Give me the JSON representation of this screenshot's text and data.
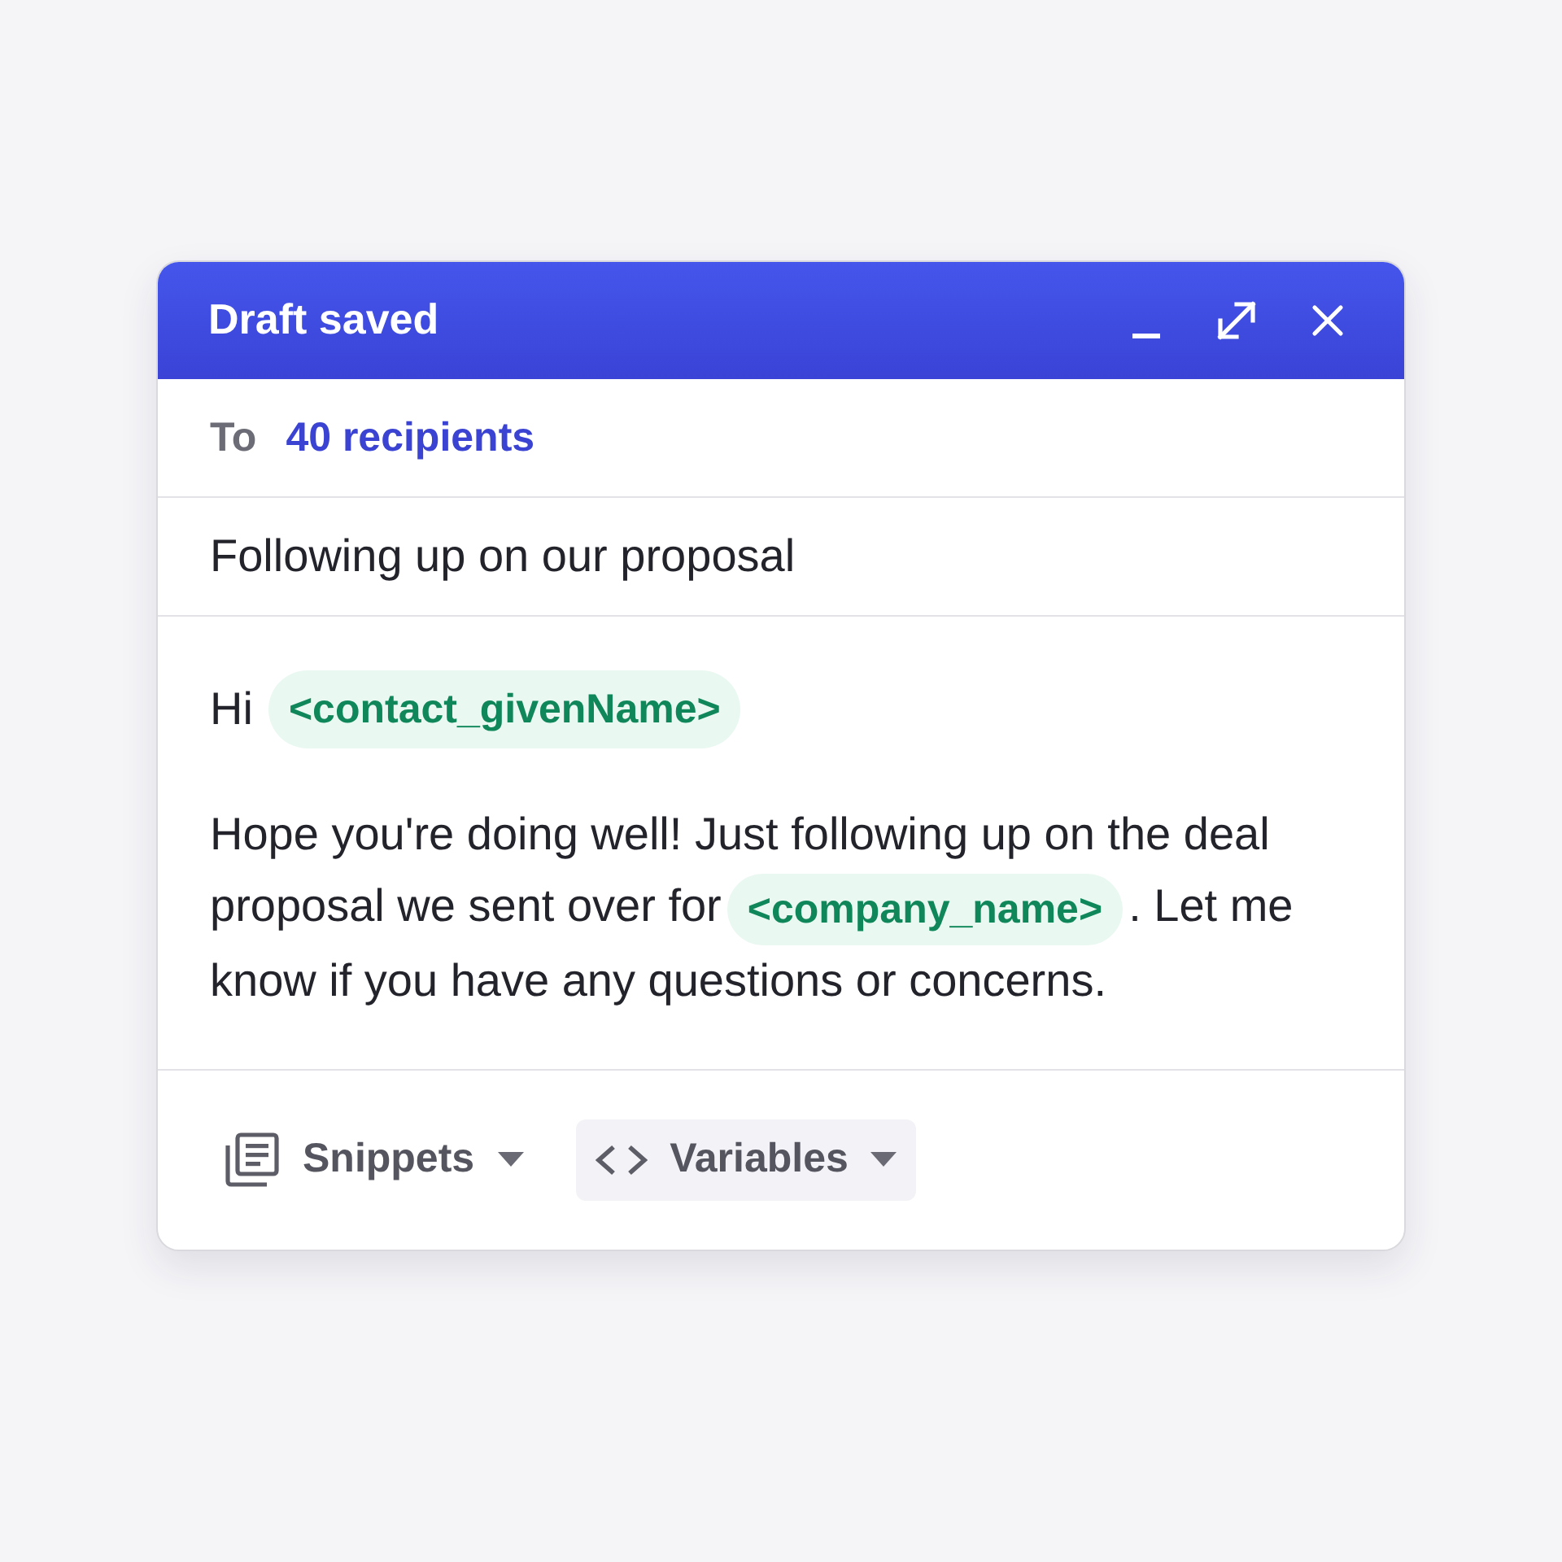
{
  "window": {
    "title": "Draft saved"
  },
  "to": {
    "label": "To",
    "recipients": "40 recipients"
  },
  "subject": "Following up on our proposal",
  "body": {
    "greeting": [
      {
        "kind": "text",
        "text": "Hi"
      },
      {
        "kind": "variable",
        "text": "<contact_givenName>"
      }
    ],
    "paragraph": [
      {
        "kind": "text",
        "text": "Hope you're doing well! Just following up on the deal proposal we sent over for"
      },
      {
        "kind": "variable",
        "text": "<company_name>"
      },
      {
        "kind": "text",
        "text": ". Let me know if you have any questions or concerns."
      }
    ]
  },
  "toolbar": [
    {
      "kind": "snippets",
      "label": "Snippets",
      "selected": false
    },
    {
      "kind": "variables",
      "label": "Variables",
      "selected": true
    }
  ]
}
